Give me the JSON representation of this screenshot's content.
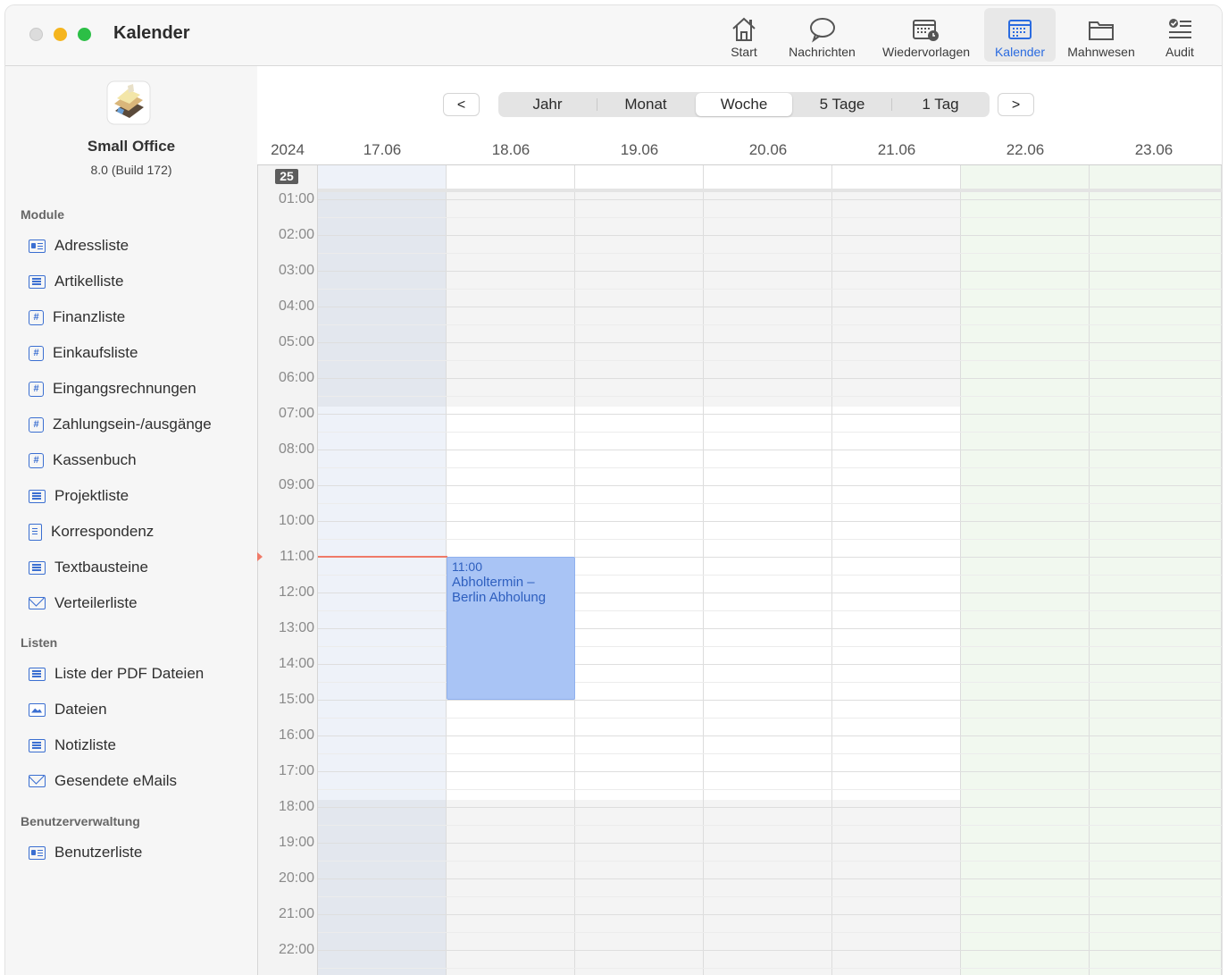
{
  "window": {
    "title": "Kalender"
  },
  "toolbar": {
    "items": [
      {
        "label": "Start",
        "icon": "house-icon"
      },
      {
        "label": "Nachrichten",
        "icon": "speech-bubble-icon"
      },
      {
        "label": "Wiedervorlagen",
        "icon": "calendar-clock-icon"
      },
      {
        "label": "Kalender",
        "icon": "calendar-icon",
        "active": true
      },
      {
        "label": "Mahnwesen",
        "icon": "folder-icon"
      },
      {
        "label": "Audit",
        "icon": "checklist-icon"
      }
    ]
  },
  "sidebar": {
    "app_name": "Small Office",
    "app_version": "8.0 (Build 172)",
    "sections": [
      {
        "title": "Module",
        "items": [
          {
            "label": "Adressliste",
            "icon": "contact-card-icon"
          },
          {
            "label": "Artikelliste",
            "icon": "list-icon"
          },
          {
            "label": "Finanzliste",
            "icon": "hash-icon"
          },
          {
            "label": "Einkaufsliste",
            "icon": "hash-icon"
          },
          {
            "label": "Eingangsrechnungen",
            "icon": "hash-icon"
          },
          {
            "label": "Zahlungsein-/ausgänge",
            "icon": "hash-icon"
          },
          {
            "label": "Kassenbuch",
            "icon": "hash-icon"
          },
          {
            "label": "Projektliste",
            "icon": "list-icon"
          },
          {
            "label": "Korrespondenz",
            "icon": "document-icon"
          },
          {
            "label": "Textbausteine",
            "icon": "list-icon"
          },
          {
            "label": "Verteilerliste",
            "icon": "mail-icon"
          }
        ]
      },
      {
        "title": "Listen",
        "items": [
          {
            "label": "Liste der PDF Dateien",
            "icon": "list-icon"
          },
          {
            "label": "Dateien",
            "icon": "image-icon"
          },
          {
            "label": "Notizliste",
            "icon": "list-icon"
          },
          {
            "label": "Gesendete eMails",
            "icon": "mail-icon"
          }
        ]
      },
      {
        "title": "Benutzerverwaltung",
        "items": [
          {
            "label": "Benutzerliste",
            "icon": "contact-card-icon"
          }
        ]
      }
    ]
  },
  "calendar": {
    "prev_label": "<",
    "next_label": ">",
    "views": [
      {
        "label": "Jahr"
      },
      {
        "label": "Monat"
      },
      {
        "label": "Woche",
        "selected": true
      },
      {
        "label": "5 Tage"
      },
      {
        "label": "1 Tag"
      }
    ],
    "year": "2024",
    "week_number": "25",
    "days": [
      "17.06",
      "18.06",
      "19.06",
      "20.06",
      "21.06",
      "22.06",
      "23.06"
    ],
    "hours": [
      "01:00",
      "02:00",
      "03:00",
      "04:00",
      "05:00",
      "06:00",
      "07:00",
      "08:00",
      "09:00",
      "10:00",
      "11:00",
      "12:00",
      "13:00",
      "14:00",
      "15:00",
      "16:00",
      "17:00",
      "18:00",
      "19:00",
      "20:00",
      "21:00",
      "22:00"
    ],
    "current_time": "11:00",
    "event": {
      "time": "11:00",
      "title": "Abholtermin – Berlin Abholung",
      "day": "18.06",
      "start": "11:00",
      "end": "15:00"
    },
    "colors": {
      "today_column": "#eef2f9",
      "weekend_column": "#f1f8ef",
      "event": "#a9c4f5",
      "now_line": "#ef7a68",
      "accent": "#2a6be0"
    }
  }
}
